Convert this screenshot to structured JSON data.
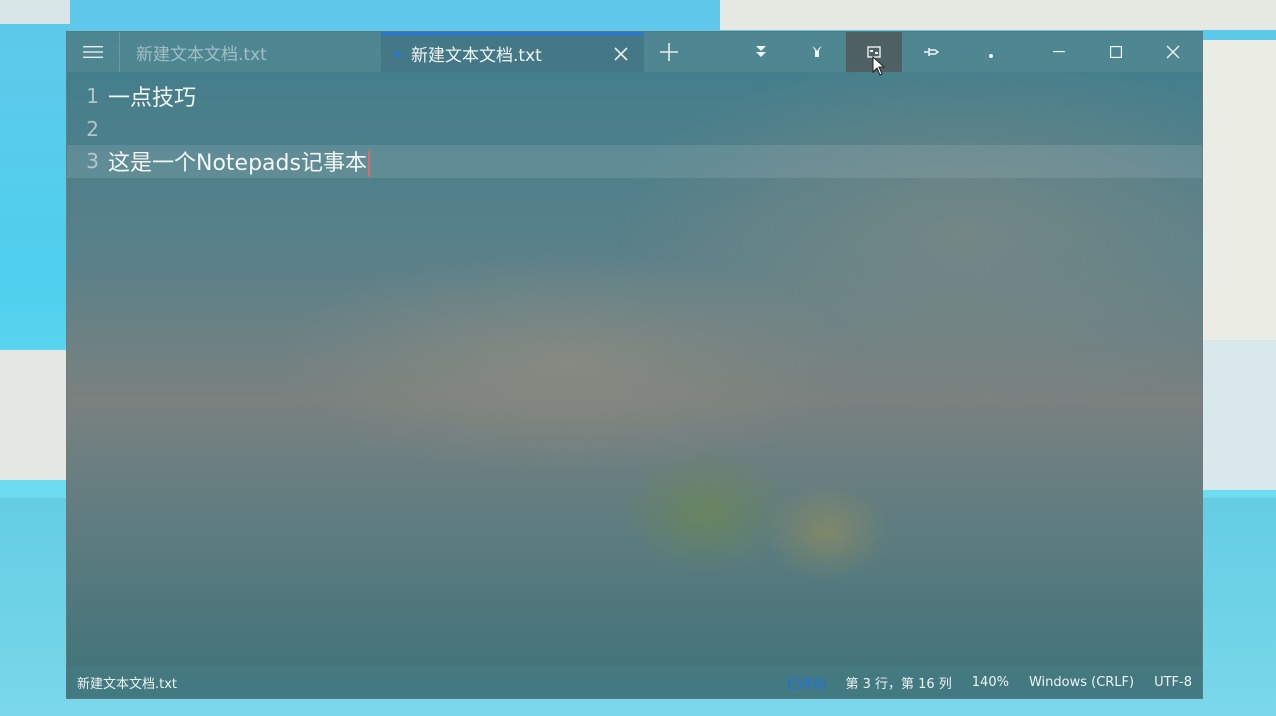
{
  "window": {
    "tabs": [
      {
        "label": "新建文本文档.txt",
        "active": false,
        "modified": false
      },
      {
        "label": "新建文本文档.txt",
        "active": true,
        "modified": true
      }
    ],
    "icons": {
      "menu": "hamburger-icon",
      "close_tab": "close-icon",
      "new_tab": "plus-icon",
      "toolbar": [
        "chevron-double-down-icon",
        "branch-icon",
        "compact-overlay-icon",
        "pin-icon",
        "more-icon"
      ],
      "window_controls": [
        "minimize-icon",
        "maximize-icon",
        "close-icon"
      ]
    },
    "accent_color": "#2a78d6"
  },
  "editor": {
    "lines": [
      {
        "number": "1",
        "text": "一点技巧"
      },
      {
        "number": "2",
        "text": ""
      },
      {
        "number": "3",
        "text": "这是一个Notepads记事本"
      }
    ]
  },
  "statusbar": {
    "file_name": "新建文本文档.txt",
    "modified": "已改动",
    "position": "第 3 行，第 16 列",
    "zoom": "140%",
    "line_ending": "Windows (CRLF)",
    "encoding": "UTF-8"
  }
}
